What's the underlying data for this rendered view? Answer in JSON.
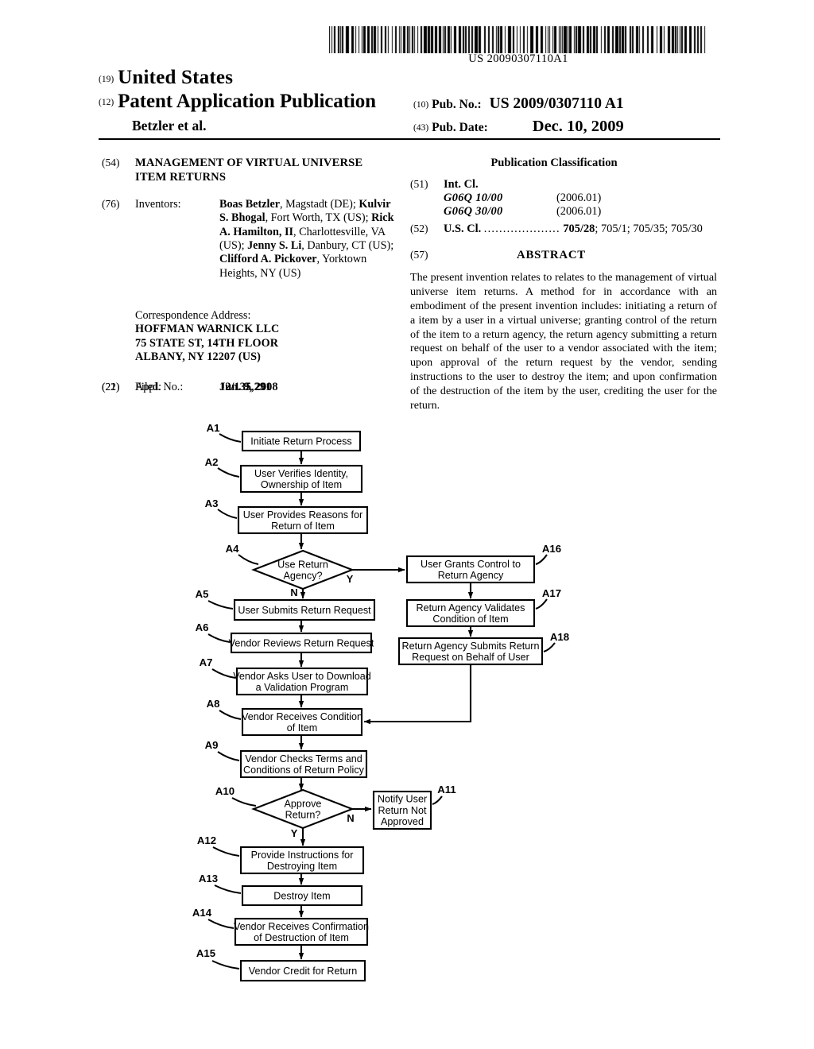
{
  "barcode": {
    "number": "US 20090307110A1"
  },
  "header": {
    "code_19": "(19)",
    "country": "United States",
    "code_12": "(12)",
    "doc_type": "Patent Application Publication",
    "applicant": "Betzler et al.",
    "code_10": "(10)",
    "pub_no_label": "Pub. No.:",
    "pub_no_value": "US 2009/0307110 A1",
    "code_43": "(43)",
    "pub_date_label": "Pub. Date:",
    "pub_date_value": "Dec. 10, 2009"
  },
  "left_column": {
    "code_54": "(54)",
    "title": "MANAGEMENT OF VIRTUAL UNIVERSE ITEM RETURNS",
    "code_76": "(76)",
    "inventors_label": "Inventors:",
    "inventors_html": "<b>Boas Betzler</b>, Magstadt (DE); <b>Kulvir S. Bhogal</b>, Fort Worth, TX (US); <b>Rick A. Hamilton, II</b>, Charlottesville, VA (US); <b>Jenny S. Li</b>, Danbury, CT (US); <b>Clifford A. Pickover</b>, Yorktown Heights, NY (US)",
    "correspondence_label": "Correspondence Address:",
    "correspondence_lines": [
      "HOFFMAN WARNICK LLC",
      "75 STATE ST, 14TH FLOOR",
      "ALBANY, NY 12207 (US)"
    ],
    "code_21": "(21)",
    "appl_no_label": "Appl. No.:",
    "appl_no_value": "12/135,291",
    "code_22": "(22)",
    "filed_label": "Filed:",
    "filed_value": "Jun. 9, 2008"
  },
  "right_column": {
    "pub_classification_heading": "Publication Classification",
    "code_51": "(51)",
    "int_cl_label": "Int. Cl.",
    "int_cl_entries": [
      {
        "code": "G06Q  10/00",
        "version": "(2006.01)"
      },
      {
        "code": "G06Q  30/00",
        "version": "(2006.01)"
      }
    ],
    "code_52": "(52)",
    "us_cl_label": "U.S. Cl.",
    "us_cl_dots": "....................",
    "us_cl_primary": "705/28",
    "us_cl_rest": "; 705/1; 705/35; 705/30",
    "code_57": "(57)",
    "abstract_heading": "ABSTRACT",
    "abstract_text": "The present invention relates to relates to the management of virtual universe item returns. A method for in accordance with an embodiment of the present invention includes: initiating a return of a item by a user in a virtual universe; granting control of the return of the item to a return agency, the return agency submitting a return request on behalf of the user to a vendor associated with the item; upon approval of the return request by the vendor, sending instructions to the user to destroy the item; and upon confirmation of the destruction of the item by the user, crediting the user for the return."
  },
  "flowchart": {
    "nodes": [
      {
        "id": "A1",
        "ref": "A1",
        "shape": "box",
        "lines": [
          "Initiate Return Process"
        ]
      },
      {
        "id": "A2",
        "ref": "A2",
        "shape": "box",
        "lines": [
          "User Verifies Identity,",
          "Ownership of Item"
        ]
      },
      {
        "id": "A3",
        "ref": "A3",
        "shape": "box",
        "lines": [
          "User Provides Reasons for",
          "Return of Item"
        ]
      },
      {
        "id": "A4",
        "ref": "A4",
        "shape": "diamond",
        "lines": [
          "Use Return",
          "Agency?"
        ]
      },
      {
        "id": "A5",
        "ref": "A5",
        "shape": "box",
        "lines": [
          "User Submits Return Request"
        ]
      },
      {
        "id": "A6",
        "ref": "A6",
        "shape": "box",
        "lines": [
          "Vendor Reviews Return Request"
        ]
      },
      {
        "id": "A7",
        "ref": "A7",
        "shape": "box",
        "lines": [
          "Vendor Asks User to Download",
          "a Validation Program"
        ]
      },
      {
        "id": "A8",
        "ref": "A8",
        "shape": "box",
        "lines": [
          "Vendor Receives Condition",
          "of Item"
        ]
      },
      {
        "id": "A9",
        "ref": "A9",
        "shape": "box",
        "lines": [
          "Vendor Checks Terms and",
          "Conditions of Return Policy"
        ]
      },
      {
        "id": "A10",
        "ref": "A10",
        "shape": "diamond",
        "lines": [
          "Approve",
          "Return?"
        ]
      },
      {
        "id": "A11",
        "ref": "A11",
        "shape": "box",
        "lines": [
          "Notify User",
          "Return Not",
          "Approved"
        ]
      },
      {
        "id": "A12",
        "ref": "A12",
        "shape": "box",
        "lines": [
          "Provide Instructions for",
          "Destroying Item"
        ]
      },
      {
        "id": "A13",
        "ref": "A13",
        "shape": "box",
        "lines": [
          "Destroy Item"
        ]
      },
      {
        "id": "A14",
        "ref": "A14",
        "shape": "box",
        "lines": [
          "Vendor Receives Confirmation",
          "of Destruction of Item"
        ]
      },
      {
        "id": "A15",
        "ref": "A15",
        "shape": "box",
        "lines": [
          "Vendor Credit for Return"
        ]
      },
      {
        "id": "A16",
        "ref": "A16",
        "shape": "box",
        "lines": [
          "User Grants Control to",
          "Return Agency"
        ]
      },
      {
        "id": "A17",
        "ref": "A17",
        "shape": "box",
        "lines": [
          "Return Agency Validates",
          "Condition of Item"
        ]
      },
      {
        "id": "A18",
        "ref": "A18",
        "shape": "box",
        "lines": [
          "Return Agency Submits Return",
          "Request on Behalf of User"
        ]
      }
    ],
    "branch_labels": [
      {
        "id": "A4-yes",
        "text": "Y"
      },
      {
        "id": "A4-no",
        "text": "N"
      },
      {
        "id": "A10-yes",
        "text": "Y"
      },
      {
        "id": "A10-no",
        "text": "N"
      }
    ],
    "colors": {
      "stroke": "#000000",
      "fill": "#ffffff"
    }
  }
}
